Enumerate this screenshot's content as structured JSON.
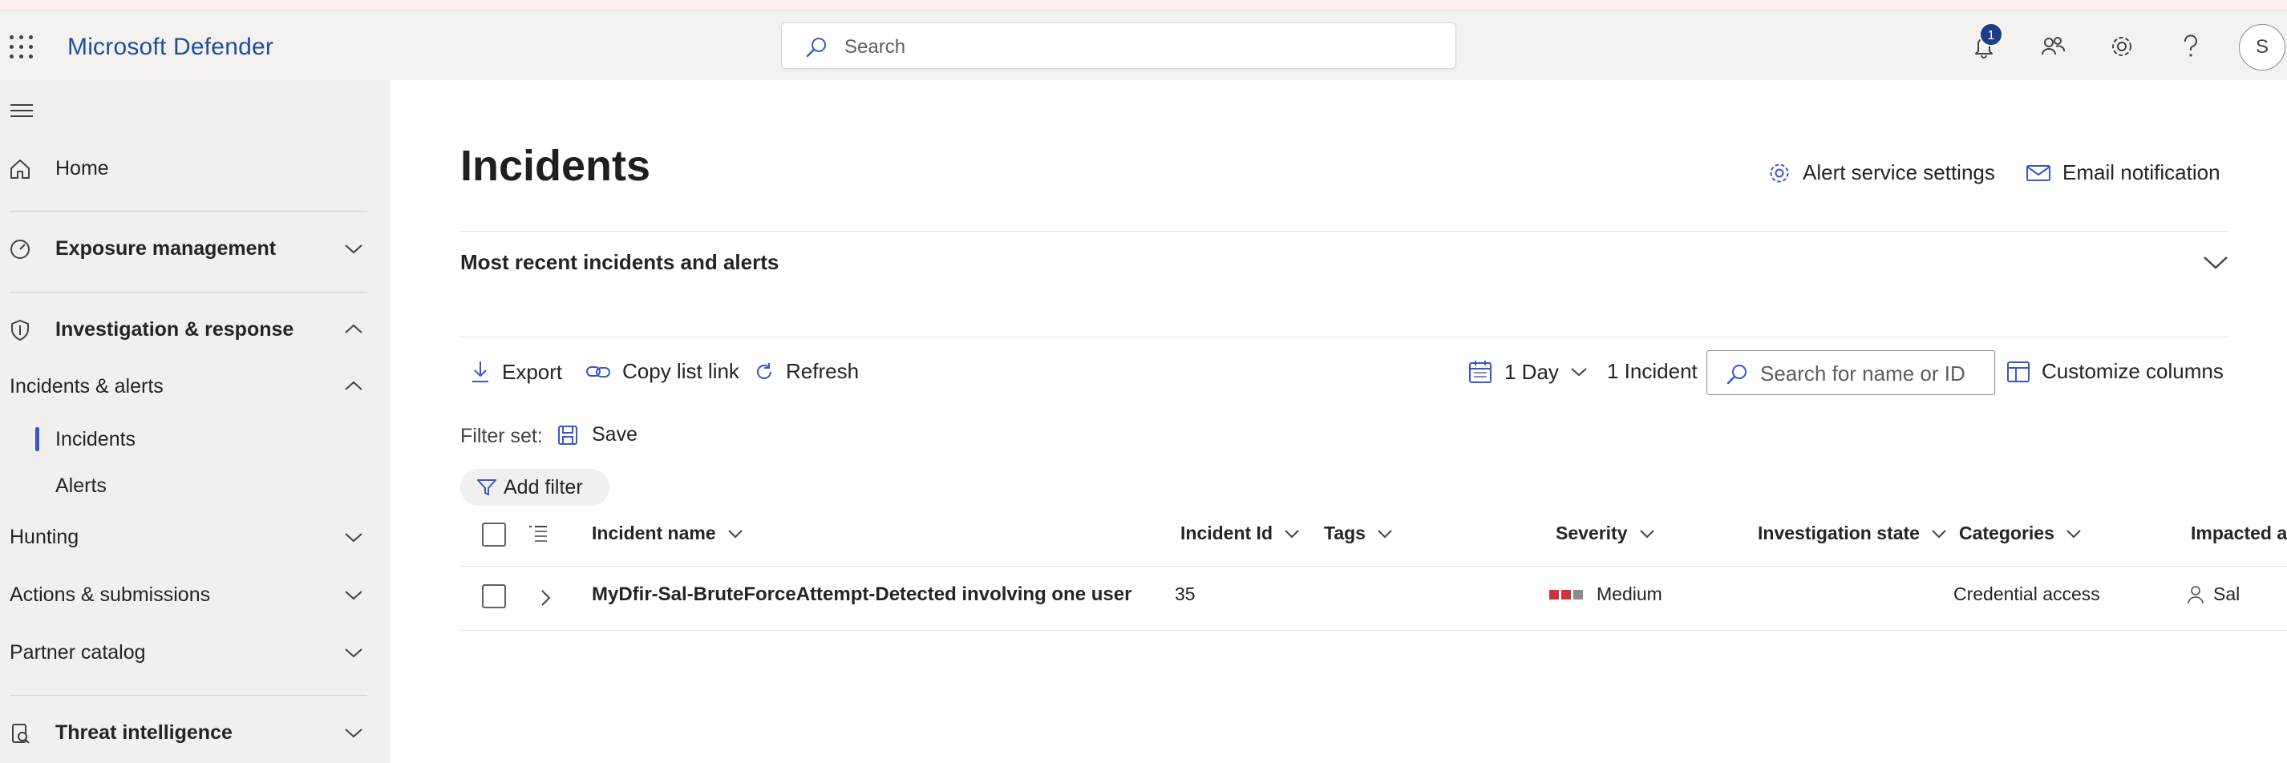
{
  "app": {
    "title": "Microsoft Defender",
    "search_placeholder": "Search",
    "notification_count": "1",
    "avatar_initial": "S"
  },
  "icons": {
    "app_launcher": "waffle-icon",
    "search": "search-icon",
    "notifications": "bell-icon",
    "community": "people-icon",
    "settings": "gear-icon",
    "help": "question-icon",
    "menu": "hamburger-icon"
  },
  "sidebar": {
    "home": "Home",
    "exposure": "Exposure management",
    "investigation": "Investigation & response",
    "incidents_alerts": "Incidents & alerts",
    "incidents": "Incidents",
    "alerts": "Alerts",
    "hunting": "Hunting",
    "actions": "Actions & submissions",
    "partner": "Partner catalog",
    "threat_intel": "Threat intelligence"
  },
  "page": {
    "title": "Incidents",
    "alert_service_settings": "Alert service settings",
    "email_notification": "Email notification",
    "most_recent": "Most recent incidents and alerts"
  },
  "toolbar": {
    "export": "Export",
    "copy_link": "Copy list link",
    "refresh": "Refresh",
    "time_range": "1 Day",
    "incident_count": "1 Incident",
    "search_placeholder": "Search for name or ID",
    "customize": "Customize columns"
  },
  "filters": {
    "filter_set_label": "Filter set:",
    "save": "Save",
    "add_filter": "Add filter"
  },
  "table": {
    "columns": {
      "name": "Incident name",
      "id": "Incident Id",
      "tags": "Tags",
      "severity": "Severity",
      "investigation_state": "Investigation state",
      "categories": "Categories",
      "impacted": "Impacted as"
    },
    "rows": [
      {
        "name": "MyDfir-Sal-BruteForceAttempt-Detected involving one user",
        "id": "35",
        "tags": "",
        "severity": "Medium",
        "investigation_state": "",
        "categories": "Credential access",
        "impacted": "Sal"
      }
    ]
  },
  "colors": {
    "brand": "#1b4f9c",
    "nav_selected": "#3a56c7",
    "severity_high": "#d13438",
    "severity_inactive": "#8a8a8a",
    "badge": "#1b3e87"
  }
}
